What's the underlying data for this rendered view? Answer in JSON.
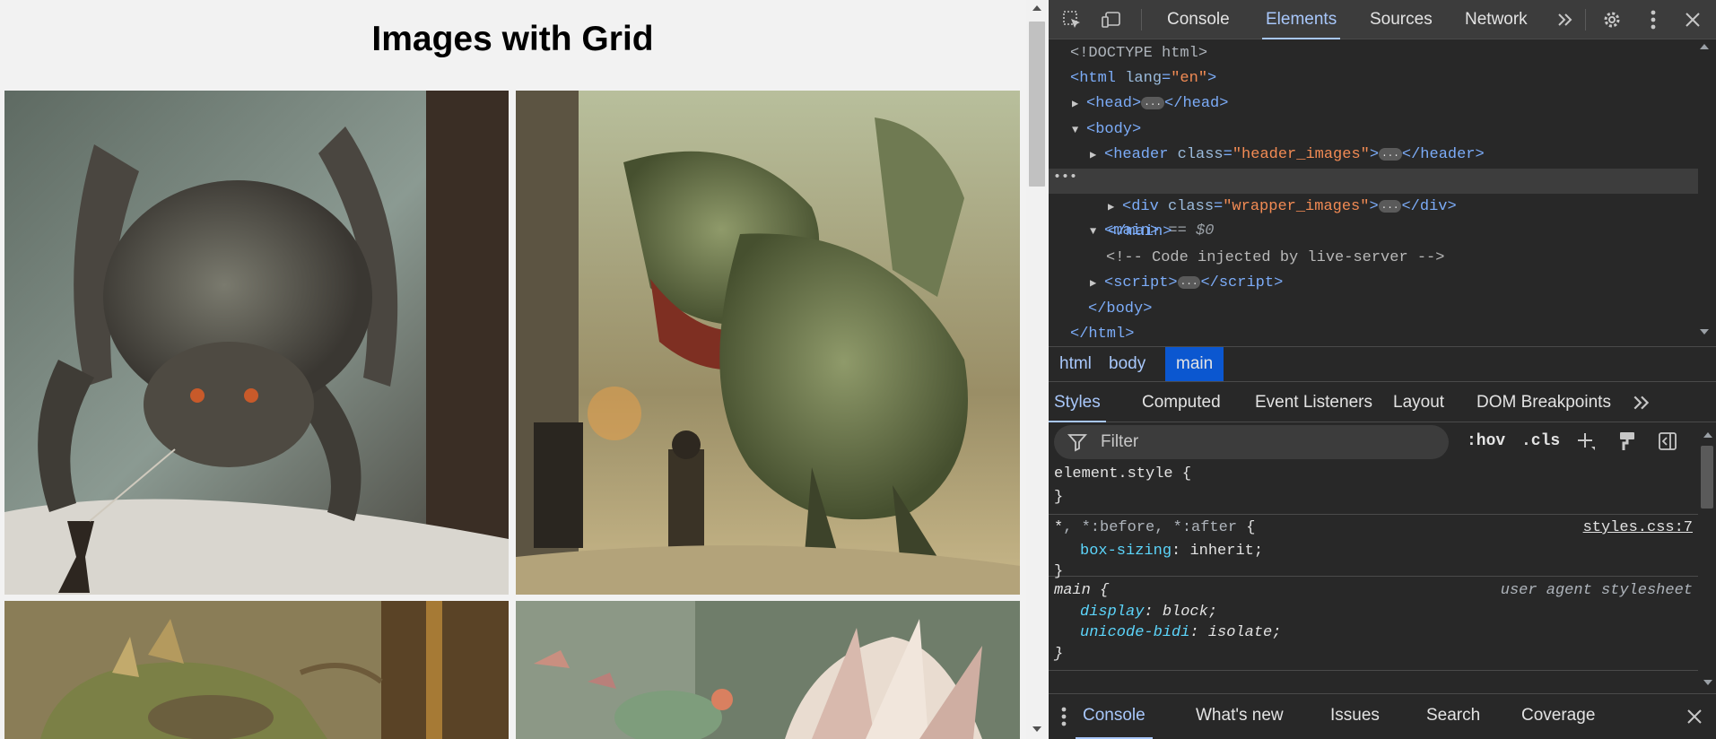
{
  "page": {
    "title": "Images with Grid",
    "images": [
      {
        "subject": "giant spider creature attacked by a small warrior with a spear"
      },
      {
        "subject": "roaring tyrannosaurus rex charging at two soldiers"
      },
      {
        "subject": "armored horned lizard creature in ornate room"
      },
      {
        "subject": "feathered bird-like creature in a forest"
      }
    ]
  },
  "devtools": {
    "toolbar": {
      "tabs": [
        "Console",
        "Elements",
        "Sources",
        "Network"
      ],
      "active_tab": "Elements",
      "more_tabs_icon": "chevron-double-right-icon",
      "icons": [
        "inspect-element-icon",
        "device-toolbar-icon",
        "settings-gear-icon",
        "more-vertical-icon",
        "close-icon"
      ]
    },
    "dom": {
      "doctype": "<!DOCTYPE html>",
      "html_tag": "html",
      "html_attr": "lang",
      "html_attr_val": "\"en\"",
      "head_tag": "head",
      "body_tag": "body",
      "header_tag": "header",
      "header_attr": "class",
      "header_attr_val": "\"header_images\"",
      "main_tag": "main",
      "selected_marker": "== $0",
      "div_tag": "div",
      "div_attr": "class",
      "div_attr_val": "\"wrapper_images\"",
      "comment": "<!-- Code injected by live-server -->",
      "script_tag": "script",
      "row_menu": "..."
    },
    "breadcrumbs": [
      "html",
      "body",
      "main"
    ],
    "active_breadcrumb": "main",
    "sub_tabs": [
      "Styles",
      "Computed",
      "Event Listeners",
      "Layout",
      "DOM Breakpoints"
    ],
    "active_sub_tab": "Styles",
    "styles_toolbar": {
      "filter_placeholder": "Filter",
      "hov_label": ":hov",
      "cls_label": ".cls"
    },
    "styles": {
      "rule1": {
        "selector": "element.style {",
        "close": "}"
      },
      "rule2": {
        "selector_main": "*",
        "selector_rest": ", *:before, *:after",
        "brace": " {",
        "source": "styles.css:7",
        "prop": "box-sizing",
        "val": "inherit;",
        "close": "}"
      },
      "rule3": {
        "selector": "main {",
        "source": "user agent stylesheet",
        "prop1": "display",
        "val1": "block;",
        "prop2": "unicode-bidi",
        "val2": "isolate;",
        "close": "}"
      }
    },
    "drawer": {
      "tabs": [
        "Console",
        "What's new",
        "Issues",
        "Search",
        "Coverage"
      ],
      "active_tab": "Console"
    }
  }
}
